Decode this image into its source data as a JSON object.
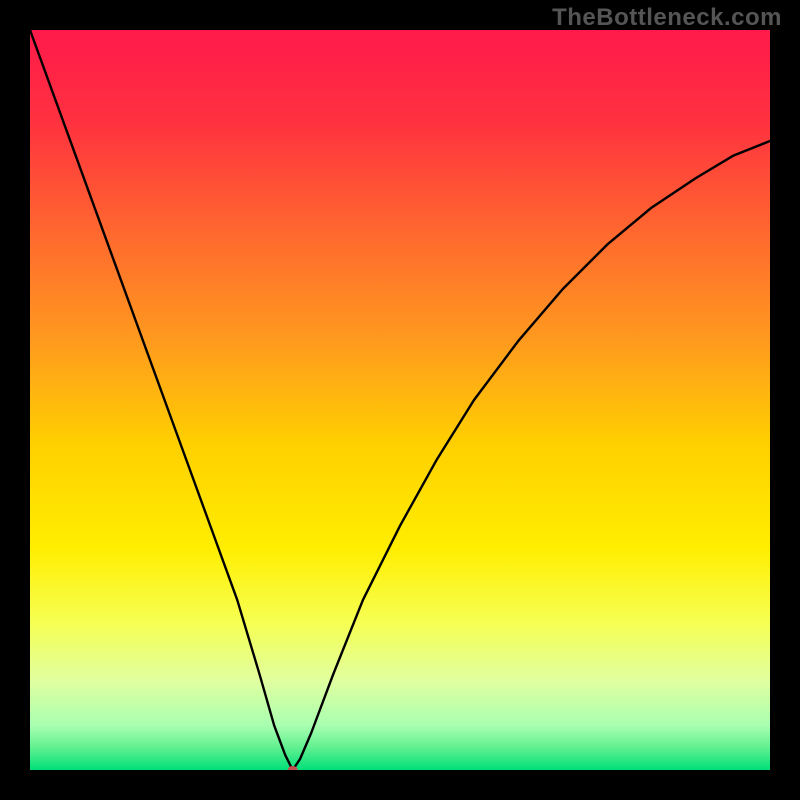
{
  "watermark": "TheBottleneck.com",
  "chart_data": {
    "type": "line",
    "title": "",
    "xlabel": "",
    "ylabel": "",
    "xlim": [
      0,
      100
    ],
    "ylim": [
      0,
      100
    ],
    "background_gradient_stops": [
      {
        "offset": 0.0,
        "color": "#ff1a4b"
      },
      {
        "offset": 0.12,
        "color": "#ff3040"
      },
      {
        "offset": 0.28,
        "color": "#ff6a2e"
      },
      {
        "offset": 0.42,
        "color": "#ff9a1e"
      },
      {
        "offset": 0.56,
        "color": "#ffd000"
      },
      {
        "offset": 0.7,
        "color": "#ffee00"
      },
      {
        "offset": 0.8,
        "color": "#f6ff52"
      },
      {
        "offset": 0.88,
        "color": "#e0ffa0"
      },
      {
        "offset": 0.94,
        "color": "#a8ffb0"
      },
      {
        "offset": 0.97,
        "color": "#60f090"
      },
      {
        "offset": 1.0,
        "color": "#00e07a"
      }
    ],
    "series": [
      {
        "name": "bottleneck-curve",
        "color": "#000000",
        "x": [
          0,
          4,
          8,
          12,
          16,
          20,
          24,
          28,
          31,
          33,
          34.5,
          35.5,
          36.5,
          38,
          41,
          45,
          50,
          55,
          60,
          66,
          72,
          78,
          84,
          90,
          95,
          100
        ],
        "values": [
          100,
          89,
          78,
          67,
          56,
          45,
          34,
          23,
          13,
          6,
          2,
          0,
          1.5,
          5,
          13,
          23,
          33,
          42,
          50,
          58,
          65,
          71,
          76,
          80,
          83,
          85
        ]
      }
    ],
    "marker": {
      "name": "optimal-point",
      "x": 35.5,
      "y": 0,
      "color": "#c0504d",
      "rx": 5,
      "ry": 4
    }
  }
}
